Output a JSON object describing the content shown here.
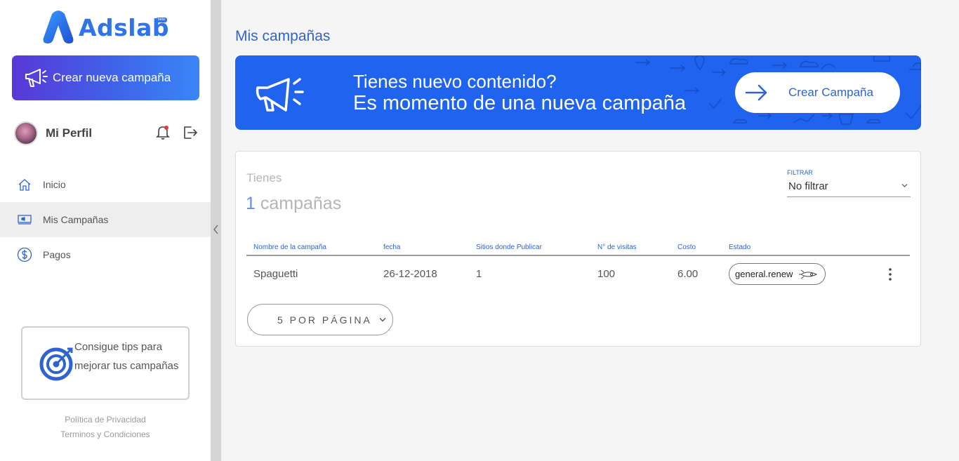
{
  "brand": {
    "name": "Adslab",
    "badge": "beta",
    "accent": "#2f74ea"
  },
  "sidebar": {
    "create_button": "Crear nueva campaña",
    "profile_name": "Mi Perfil",
    "nav": [
      {
        "label": "Inicio",
        "icon": "home-icon"
      },
      {
        "label": "Mis Campañas",
        "icon": "campaign-icon",
        "active": true
      },
      {
        "label": "Pagos",
        "icon": "dollar-icon"
      }
    ],
    "tips_text": "Consigue tips para mejorar tus campañas",
    "footer": {
      "privacy": "Política de Privacidad",
      "terms": "Terminos y Condiciones"
    }
  },
  "main": {
    "title": "Mis campañas",
    "banner": {
      "line1": "Tienes nuevo contenido?",
      "line2": "Es momento de una nueva campaña",
      "cta": "Crear Campaña",
      "bg": "#1f63ee"
    },
    "summary": {
      "prefix": "Tienes",
      "count": "1",
      "suffix": "campañas"
    },
    "filter": {
      "label": "FILTRAR",
      "value": "No filtrar"
    },
    "table": {
      "headers": [
        "Nombre de la campaña",
        "fecha",
        "Sitios donde Publicar",
        "N° de visitas",
        "Costo",
        "Estado"
      ],
      "rows": [
        {
          "name": "Spaguetti",
          "date": "26-12-2018",
          "sites": "1",
          "visits": "100",
          "cost": "6.00",
          "status": "general.renew"
        }
      ]
    },
    "per_page": "5 POR PÁGINA"
  }
}
